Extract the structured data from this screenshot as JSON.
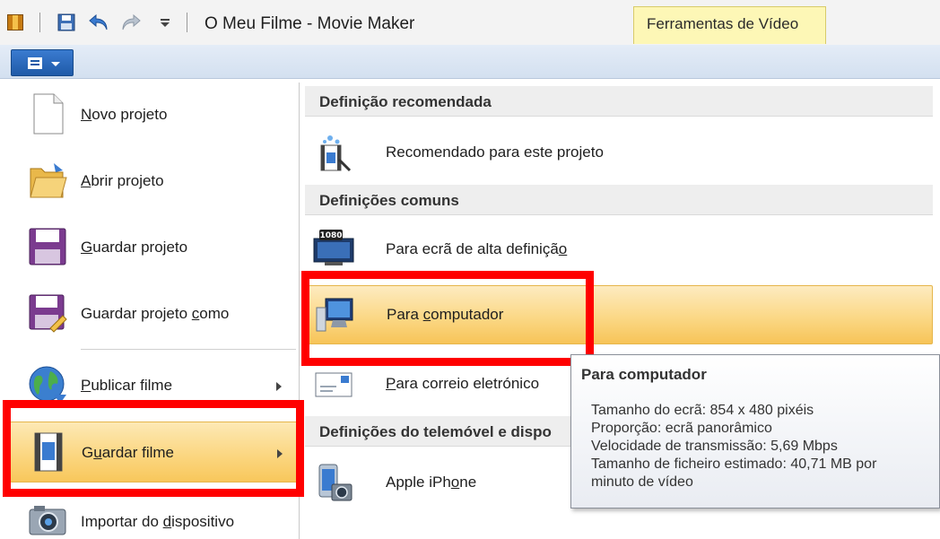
{
  "window": {
    "title": "O Meu Filme - Movie Maker",
    "contextual_tab": "Ferramentas de Vídeo"
  },
  "quick_access": [
    {
      "icon": "save-icon"
    },
    {
      "icon": "undo-icon"
    },
    {
      "icon": "redo-icon"
    },
    {
      "icon": "customize-dropdown-icon"
    }
  ],
  "file_menu": {
    "button_icon": "file-menu-icon",
    "items": [
      {
        "label_before": "",
        "accel": "N",
        "label_after": "ovo projeto",
        "icon": "new-document-icon",
        "submenu": false
      },
      {
        "label_before": "",
        "accel": "A",
        "label_after": "brir projeto",
        "icon": "open-folder-icon",
        "submenu": false
      },
      {
        "label_before": "",
        "accel": "G",
        "label_after": "uardar projeto",
        "icon": "save-project-icon",
        "submenu": false
      },
      {
        "label_before": "Guardar projeto ",
        "accel": "c",
        "label_after": "omo",
        "icon": "save-as-icon",
        "submenu": false
      },
      {
        "label_before": "",
        "accel": "P",
        "label_after": "ublicar filme",
        "icon": "globe-icon",
        "submenu": true
      },
      {
        "label_before": "G",
        "accel": "u",
        "label_after": "ardar filme",
        "icon": "film-save-icon",
        "submenu": true,
        "highlighted": true
      },
      {
        "label_before": "Importar do ",
        "accel": "d",
        "label_after": "ispositivo",
        "icon": "camera-icon",
        "submenu": false
      }
    ]
  },
  "save_movie_submenu": {
    "sections": [
      {
        "header": "Definição recomendada",
        "items": [
          {
            "label_before": "Recomendado para este pro",
            "accel": "j",
            "label_after": "eto",
            "icon": "recommended-icon"
          }
        ]
      },
      {
        "header": "Definições comuns",
        "items": [
          {
            "label_before": "Para ecrã de alta definiçã",
            "accel": "o",
            "label_after": "",
            "icon": "hd-1080-icon",
            "badge": "1080"
          },
          {
            "label_before": "Para ",
            "accel": "c",
            "label_after": "omputador",
            "icon": "computer-icon",
            "highlighted": true
          },
          {
            "label_before": "",
            "accel": "P",
            "label_after": "ara correio eletrónico",
            "icon": "email-icon"
          }
        ]
      },
      {
        "header": "Definições do telemóvel e dispo",
        "items": [
          {
            "label_before": "Apple iPh",
            "accel": "o",
            "label_after": "ne",
            "icon": "iphone-icon"
          }
        ]
      }
    ]
  },
  "tooltip": {
    "title": "Para computador",
    "lines": [
      "Tamanho do ecrã: 854 x 480 pixéis",
      "Proporção: ecrã panorâmico",
      "Velocidade de transmissão: 5,69 Mbps",
      "Tamanho de ficheiro estimado: 40,71 MB por",
      "minuto de vídeo"
    ]
  },
  "colors": {
    "highlight_box": "#ff0000",
    "hover_orange": "#f8c75b",
    "contextual_tab": "#fdf7b6",
    "menu_button": "#1f5aa8"
  }
}
